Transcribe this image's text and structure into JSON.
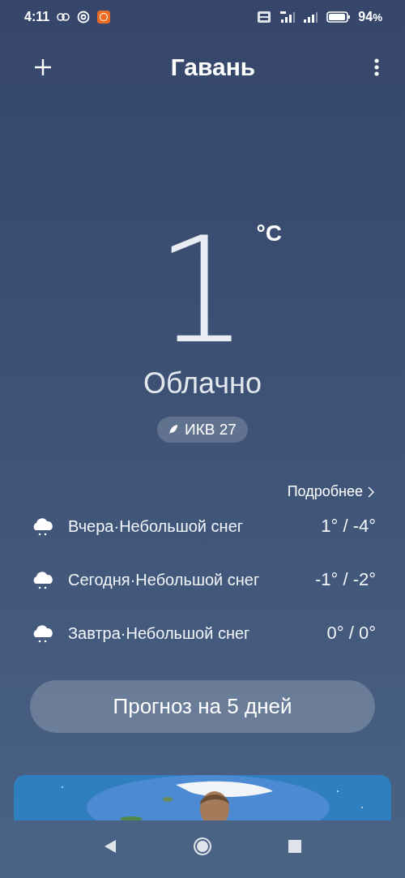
{
  "status_bar": {
    "time": "4:11",
    "battery": "94",
    "battery_unit": "%"
  },
  "header": {
    "title": "Гавань"
  },
  "current": {
    "temperature": "1",
    "unit": "°C",
    "condition": "Облачно",
    "aqi": "ИКВ 27"
  },
  "more_link": "Подробнее",
  "forecast": [
    {
      "day": "Вчера",
      "separator": "·",
      "condition": "Небольшой снег",
      "temps": "1° / -4°"
    },
    {
      "day": "Сегодня",
      "separator": "·",
      "condition": "Небольшой снег",
      "temps": "-1° / -2°"
    },
    {
      "day": "Завтра",
      "separator": "·",
      "condition": "Небольшой снег",
      "temps": "0° / 0°"
    }
  ],
  "forecast_button": "Прогноз на 5 дней"
}
